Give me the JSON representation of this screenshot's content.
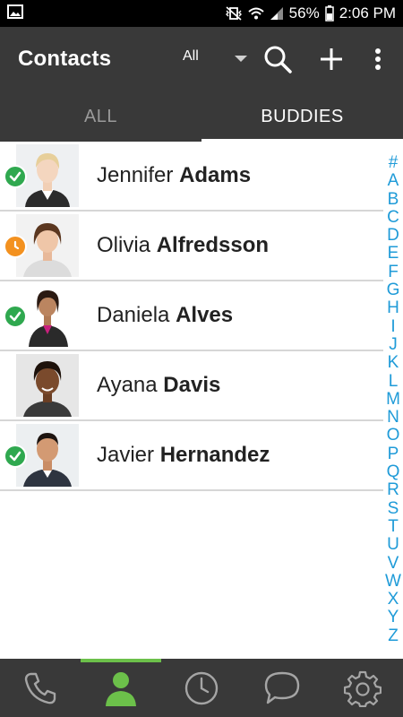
{
  "status_bar": {
    "battery_percent": "56%",
    "time": "2:06 PM"
  },
  "app_bar": {
    "title": "Contacts",
    "filter_value": "All"
  },
  "tabs": [
    {
      "label": "ALL",
      "selected": false
    },
    {
      "label": "BUDDIES",
      "selected": true
    }
  ],
  "contacts": [
    {
      "first": "Jennifer",
      "last": "Adams",
      "presence": "available"
    },
    {
      "first": "Olivia",
      "last": "Alfredsson",
      "presence": "away"
    },
    {
      "first": "Daniela",
      "last": "Alves",
      "presence": "available"
    },
    {
      "first": "Ayana",
      "last": "Davis",
      "presence": "none"
    },
    {
      "first": "Javier",
      "last": "Hernandez",
      "presence": "available"
    }
  ],
  "alphabet_index": [
    "#",
    "A",
    "B",
    "C",
    "D",
    "E",
    "F",
    "G",
    "H",
    "I",
    "J",
    "K",
    "L",
    "M",
    "N",
    "O",
    "P",
    "Q",
    "R",
    "S",
    "T",
    "U",
    "V",
    "W",
    "X",
    "Y",
    "Z"
  ],
  "bottom_nav": [
    {
      "icon": "phone-icon",
      "active": false
    },
    {
      "icon": "contacts-icon",
      "active": true
    },
    {
      "icon": "history-clock-icon",
      "active": false
    },
    {
      "icon": "chat-bubble-icon",
      "active": false
    },
    {
      "icon": "settings-gear-icon",
      "active": false
    }
  ],
  "colors": {
    "app_bar": "#393939",
    "available": "#2fa84f",
    "away": "#f3911f",
    "index_letters": "#1f9bd8",
    "nav_active": "#6cc04a"
  }
}
